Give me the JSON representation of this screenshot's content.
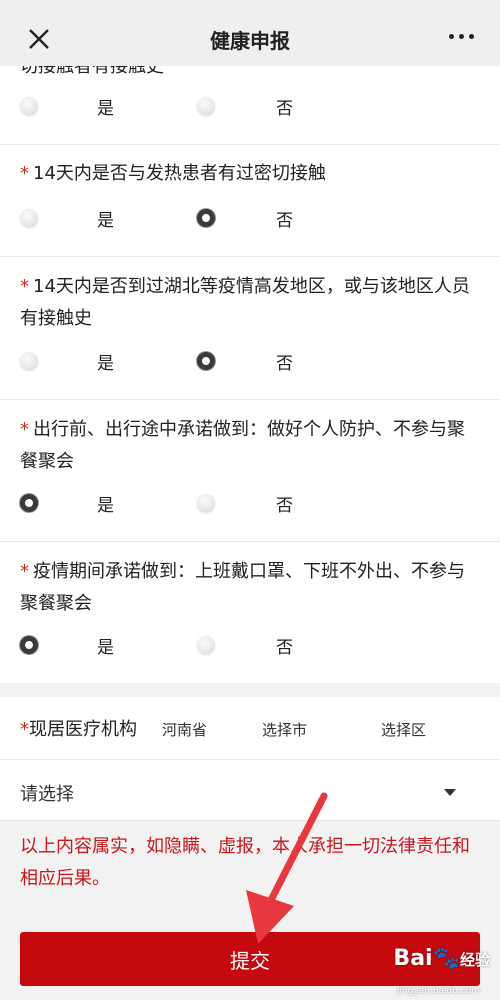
{
  "header": {
    "title": "健康申报"
  },
  "partial_question": "切接触者有接触史",
  "questions": [
    {
      "text": "",
      "options": [
        {
          "label": "是",
          "selected": false
        },
        {
          "label": "否",
          "selected": false
        }
      ]
    },
    {
      "text": "14天内是否与发热患者有过密切接触",
      "options": [
        {
          "label": "是",
          "selected": false
        },
        {
          "label": "否",
          "selected": true
        }
      ]
    },
    {
      "text": "14天内是否到过湖北等疫情高发地区，或与该地区人员有接触史",
      "options": [
        {
          "label": "是",
          "selected": false
        },
        {
          "label": "否",
          "selected": true
        }
      ]
    },
    {
      "text": "出行前、出行途中承诺做到：做好个人防护、不参与聚餐聚会",
      "options": [
        {
          "label": "是",
          "selected": true
        },
        {
          "label": "否",
          "selected": false
        }
      ]
    },
    {
      "text": "疫情期间承诺做到：上班戴口罩、下班不外出、不参与聚餐聚会",
      "options": [
        {
          "label": "是",
          "selected": true
        },
        {
          "label": "否",
          "selected": false
        }
      ]
    }
  ],
  "required_mark": "*",
  "region": {
    "label": "现居医疗机构",
    "province": "河南省",
    "city": "选择市",
    "district": "选择区"
  },
  "select_placeholder": "请选择",
  "notice": "以上内容属实，如隐瞒、虚报，本人承担一切法律责任和相应后果。",
  "submit_label": "提交",
  "watermark": {
    "brand": "Bai",
    "brand2": "经验",
    "url": "jingyan.baidu.com"
  },
  "colors": {
    "accent": "#c40a0f",
    "notice": "#c8161d",
    "arrow": "#e8373f"
  }
}
